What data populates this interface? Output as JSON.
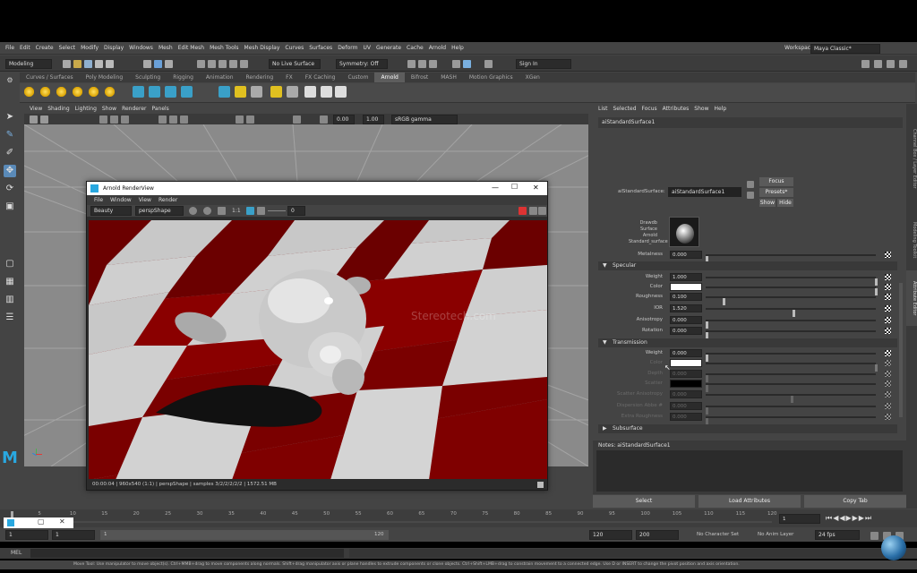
{
  "menubar": [
    "File",
    "Edit",
    "Create",
    "Select",
    "Modify",
    "Display",
    "Windows",
    "Mesh",
    "Edit Mesh",
    "Mesh Tools",
    "Mesh Display",
    "Curves",
    "Surfaces",
    "Deform",
    "UV",
    "Generate",
    "Cache",
    "Arnold",
    "Help"
  ],
  "workspace": {
    "label": "Workspace :",
    "value": "Maya Classic*"
  },
  "statusline": {
    "mode": "Modeling",
    "live_surface": "No Live Surface",
    "symmetry": "Symmetry: Off",
    "sign_in": "Sign In"
  },
  "shelf_tabs": {
    "items": [
      "Curves / Surfaces",
      "Poly Modeling",
      "Sculpting",
      "Rigging",
      "Animation",
      "Rendering",
      "FX",
      "FX Caching",
      "Custom",
      "Arnold",
      "Bifrost",
      "MASH",
      "Motion Graphics",
      "XGen"
    ],
    "active": "Arnold"
  },
  "viewport": {
    "menu": [
      "View",
      "Shading",
      "Lighting",
      "Show",
      "Renderer",
      "Panels"
    ],
    "field_a": "0.00",
    "field_b": "1.00",
    "colorspace": "sRGB gamma",
    "camera_label": "persp"
  },
  "render_view": {
    "title": "Arnold RenderView",
    "menu": [
      "File",
      "Window",
      "View",
      "Render"
    ],
    "aov": "Beauty",
    "camera": "perspShape",
    "ratio": "1:1",
    "exposure": "0",
    "status": "00:00:04 | 960x540 (1:1) | perspShape | samples 3/2/2/2/2/2 | 1572.51 MB",
    "watermark": "Stereotech.com"
  },
  "attr_editor": {
    "menu": [
      "List",
      "Selected",
      "Focus",
      "Attributes",
      "Show",
      "Help"
    ],
    "tab": "aiStandardSurface1",
    "node_label": "aiStandardSurface:",
    "node_name": "aiStandardSurface1",
    "focus_btn": "Focus",
    "presets_btn": "Presets*",
    "show_btn": "Show",
    "hide_btn": "Hide",
    "swatch_caption": [
      "Drawdb",
      "Surface",
      "Arnold",
      "Standard_surface"
    ],
    "metalness": {
      "label": "Metalness",
      "value": "0.000"
    },
    "specular": {
      "title": "Specular",
      "weight": {
        "label": "Weight",
        "value": "1.000"
      },
      "color": {
        "label": "Color"
      },
      "roughness": {
        "label": "Roughness",
        "value": "0.100"
      },
      "ior": {
        "label": "IOR",
        "value": "1.520"
      },
      "anisotropy": {
        "label": "Anisotropy",
        "value": "0.000"
      },
      "rotation": {
        "label": "Rotation",
        "value": "0.000"
      }
    },
    "transmission": {
      "title": "Transmission",
      "weight": {
        "label": "Weight",
        "value": "0.000"
      },
      "color": {
        "label": "Color"
      },
      "depth": {
        "label": "Depth",
        "value": "0.000"
      },
      "scatter": {
        "label": "Scatter"
      },
      "scatter_anisotropy": {
        "label": "Scatter Anisotropy",
        "value": "0.000"
      },
      "dispersion": {
        "label": "Dispersion Abbe #",
        "value": "0.000"
      },
      "extra_roughness": {
        "label": "Extra Roughness",
        "value": "0.000"
      }
    },
    "subsurface": {
      "title": "Subsurface"
    },
    "notes": "Notes: aiStandardSurface1",
    "buttons": {
      "select": "Select",
      "load": "Load Attributes",
      "copy": "Copy Tab"
    }
  },
  "right_tabs": [
    "Channel Box / Layer Editor",
    "Modeling Toolkit",
    "Attribute Editor"
  ],
  "timeline": {
    "ticks": [
      "5",
      "10",
      "15",
      "20",
      "25",
      "30",
      "35",
      "40",
      "45",
      "50",
      "55",
      "60",
      "65",
      "70",
      "75",
      "80",
      "85",
      "90",
      "95",
      "100",
      "105",
      "110",
      "115",
      "120"
    ],
    "current": "1"
  },
  "range": {
    "start": "1",
    "start2": "1",
    "slider_start": "1",
    "slider_end": "120",
    "end": "120",
    "end2": "200",
    "character_set": "No Character Set",
    "anim_layer": "No Anim Layer",
    "fps": "24 fps"
  },
  "cmdline": {
    "lang": "MEL"
  },
  "helpline": "Move Tool: Use manipulator to move object(s). Ctrl+MMB+drag to move components along normals. Shift+drag manipulator axis or plane handles to extrude components or clone objects. Ctrl+Shift+LMB+drag to constrain movement to a connected edge. Use D or INSERT to change the pivot position and axis orientation."
}
